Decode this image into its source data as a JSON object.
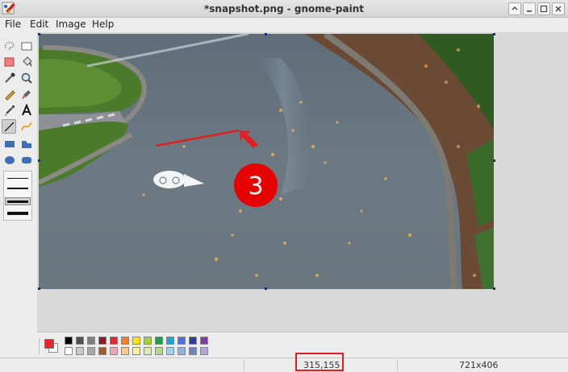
{
  "window": {
    "title": "*snapshot.png - gnome-paint",
    "controls": [
      "minimize",
      "restore",
      "maximize",
      "close"
    ]
  },
  "menu": {
    "items": [
      "File",
      "Edit",
      "Image",
      "Help"
    ]
  },
  "toolbox": {
    "tools": [
      "free-select-icon",
      "rect-select-icon",
      "eraser-icon",
      "fill-bucket-icon",
      "color-picker-icon",
      "zoom-icon",
      "pencil-icon",
      "brush-icon",
      "airbrush-icon",
      "text-tool-icon",
      "line-tool-icon",
      "curve-tool-icon",
      "rectangle-tool-icon",
      "polygon-tool-icon",
      "ellipse-tool-icon",
      "rounded-rect-tool-icon"
    ],
    "active_tool": "line-tool-icon",
    "line_widths": [
      "1px",
      "2px",
      "3px",
      "4px",
      "5px"
    ]
  },
  "canvas": {
    "annotation_label": "3",
    "annotation_colors": {
      "arrow": "#e02020",
      "circle": "#e60000",
      "label": "#ffffff"
    }
  },
  "palette": {
    "primary_color": "#e8232b",
    "secondary_color": "#ffffff",
    "row1": [
      "#000000",
      "#505050",
      "#7f7f7f",
      "#8b1a2c",
      "#e8232b",
      "#f7801e",
      "#fde60a",
      "#a5d32a",
      "#16a346",
      "#1ba3e5",
      "#4d6fe0",
      "#2d3ea0",
      "#7b3fa2"
    ],
    "row2": [
      "#ffffff",
      "#c8c8c8",
      "#a8a8a8",
      "#a05a2c",
      "#f5a3b6",
      "#fbc98a",
      "#fdf1a0",
      "#d9ecb5",
      "#b0db8a",
      "#9ad1f0",
      "#8fb0e5",
      "#6f84b7",
      "#b5a4d8"
    ]
  },
  "status": {
    "cursor_position": "315,155",
    "image_size": "721x406"
  }
}
